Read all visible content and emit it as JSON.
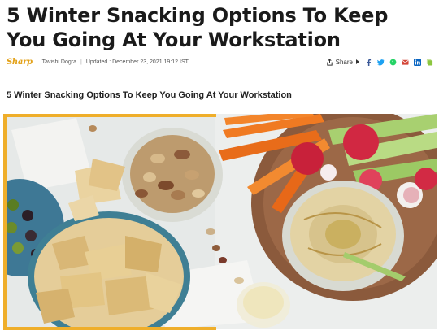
{
  "article": {
    "title": "5 Winter Snacking Options To Keep You Going At Your Workstation",
    "subtitle": "5 Winter Snacking Options To Keep You Going At Your Workstation"
  },
  "meta": {
    "logo_text": "Sharp",
    "separator": "|",
    "author": "Tavishi Dogra",
    "updated": "Updated : December 23, 2021 19:12 IST",
    "share_label": "Share"
  },
  "social_icons": [
    "facebook-icon",
    "twitter-icon",
    "whatsapp-icon",
    "email-icon",
    "linkedin-icon",
    "copy-link-icon"
  ],
  "colors": {
    "accent": "#efae2a",
    "facebook": "#3b5998",
    "twitter": "#1da1f2",
    "whatsapp": "#25d366",
    "email": "#d44638",
    "linkedin": "#0a66c2",
    "copy": "#8cc63f"
  }
}
